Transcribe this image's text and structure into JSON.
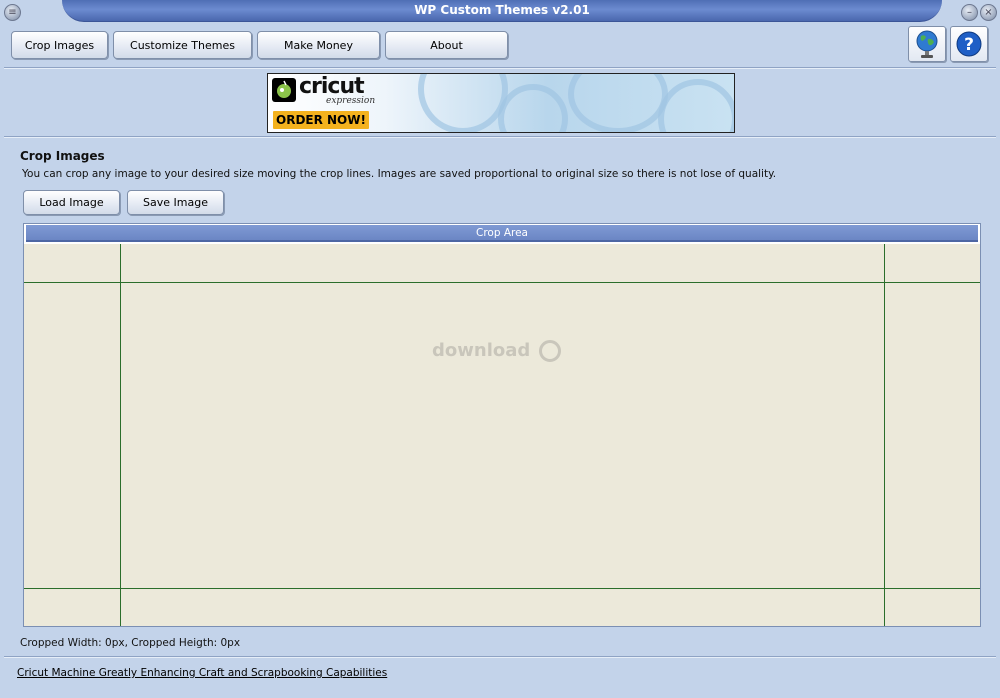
{
  "window": {
    "title": "WP Custom Themes v2.01"
  },
  "toolbar": {
    "buttons": [
      {
        "label": "Crop Images"
      },
      {
        "label": "Customize Themes"
      },
      {
        "label": "Make Money"
      },
      {
        "label": "About"
      }
    ],
    "icons": [
      "globe-icon",
      "help-icon"
    ]
  },
  "banner": {
    "brand": "cricut",
    "sub": "expression",
    "cta": "ORDER NOW!"
  },
  "crop": {
    "title": "Crop Images",
    "description": "You can crop any image to your desired size moving the crop lines. Images are saved proportional to original size so there is not lose of quality.",
    "load_label": "Load Image",
    "save_label": "Save Image",
    "area_label": "Crop Area",
    "watermark": "download",
    "status": "Cropped Width: 0px, Cropped Heigth: 0px"
  },
  "footer": {
    "link": "Cricut Machine Greatly Enhancing Craft and Scrapbooking Capabilities"
  },
  "colors": {
    "background": "#c3d3ea",
    "title_bar": "#5b79bf",
    "crop_area": "#ece9da",
    "crop_line": "#2b6e2b",
    "order_button": "#f4b21e"
  }
}
